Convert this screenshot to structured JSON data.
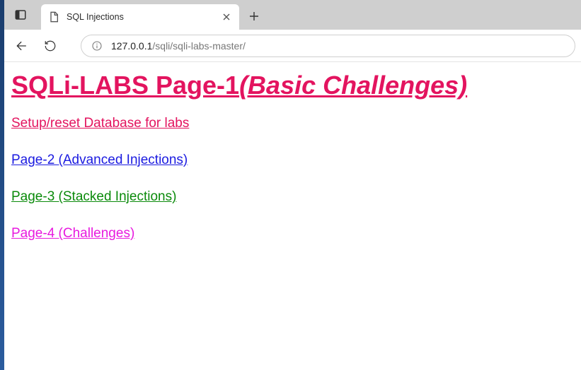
{
  "tab": {
    "title": "SQL Injections"
  },
  "url": {
    "host": "127.0.0.1",
    "path": "/sqli/sqli-labs-master/"
  },
  "header": {
    "title_part1": "SQLi-LABS Page-1",
    "title_part2": "(Basic Challenges)"
  },
  "links": {
    "setup": "Setup/reset Database for labs",
    "page2": "Page-2 (Advanced Injections)",
    "page3": "Page-3 (Stacked Injections)",
    "page4": "Page-4 (Challenges)"
  }
}
